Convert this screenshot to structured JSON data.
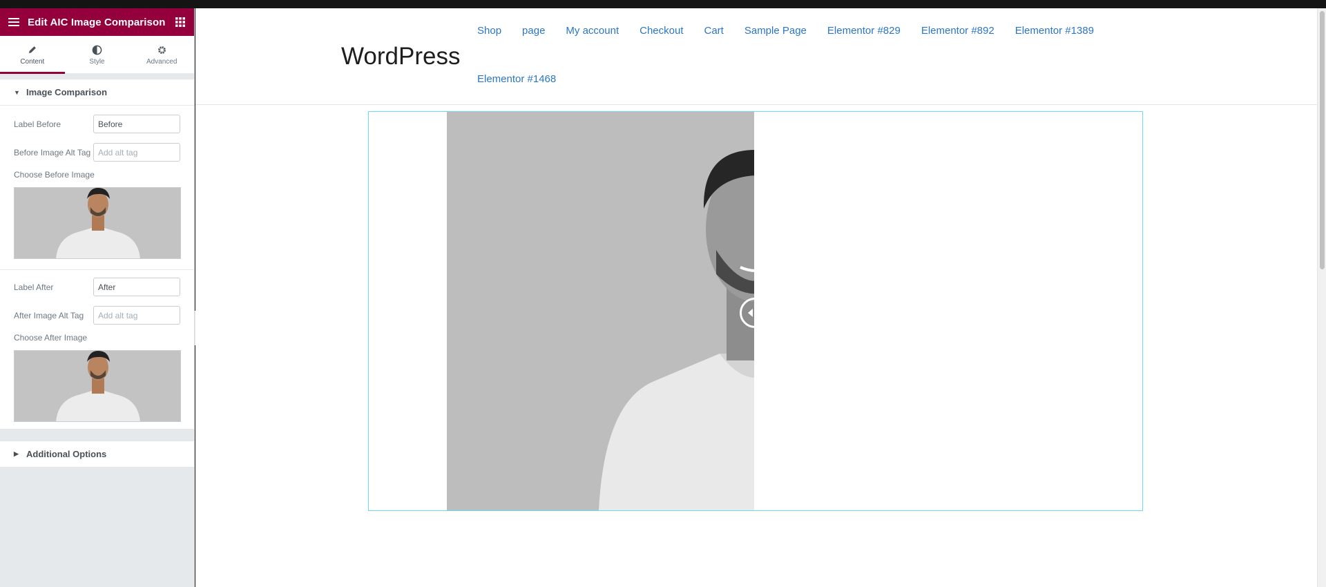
{
  "panel": {
    "title": "Edit AIC Image Comparison",
    "tabs": [
      {
        "label": "Content",
        "icon": "pencil-icon",
        "active": true
      },
      {
        "label": "Style",
        "icon": "half-circle-icon",
        "active": false
      },
      {
        "label": "Advanced",
        "icon": "gear-icon",
        "active": false
      }
    ],
    "section_title": "Image Comparison",
    "label_before": {
      "label": "Label Before",
      "value": "Before"
    },
    "before_alt": {
      "label": "Before Image Alt Tag",
      "placeholder": "Add alt tag"
    },
    "choose_before": "Choose Before Image",
    "label_after": {
      "label": "Label After",
      "value": "After"
    },
    "after_alt": {
      "label": "After Image Alt Tag",
      "placeholder": "Add alt tag"
    },
    "choose_after": "Choose After Image",
    "additional": "Additional Options",
    "accent": "#93003c"
  },
  "site": {
    "title": "WordPress",
    "nav": [
      "Shop",
      "page",
      "My account",
      "Checkout",
      "Cart",
      "Sample Page",
      "Elementor #829",
      "Elementor #892",
      "Elementor #1389",
      "Elementor #1468"
    ],
    "link_color": "#2a76c6"
  },
  "comparison": {
    "slider_position": 0.5
  }
}
